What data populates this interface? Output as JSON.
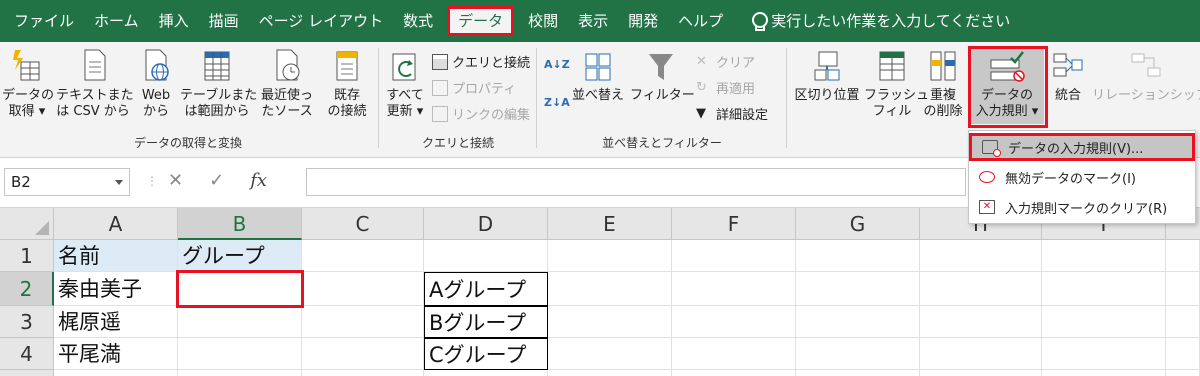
{
  "tabs": [
    "ファイル",
    "ホーム",
    "挿入",
    "描画",
    "ページ レイアウト",
    "数式",
    "データ",
    "校閲",
    "表示",
    "開発",
    "ヘルプ"
  ],
  "tell_me": "実行したい作業を入力してください",
  "ribbon": {
    "get_data": [
      "データの",
      "取得 ▾"
    ],
    "from_text": [
      "テキストまた",
      "は CSV から"
    ],
    "from_web": [
      "Web",
      "から"
    ],
    "from_table": [
      "テーブルまた",
      "は範囲から"
    ],
    "recent": [
      "最近使っ",
      "たソース"
    ],
    "existing": [
      "既存",
      "の接続"
    ],
    "refresh_all": [
      "すべて",
      "更新 ▾"
    ],
    "queries": "クエリと接続",
    "properties": "プロパティ",
    "edit_links": "リンクの編集",
    "sort": "並べ替え",
    "filter": "フィルター",
    "clear": "クリア",
    "reapply": "再適用",
    "advanced": "詳細設定",
    "text_to_columns": "区切り位置",
    "flash_fill": [
      "フラッシュ",
      "フィル"
    ],
    "remove_dup": [
      "重複",
      "の削除"
    ],
    "data_validation": [
      "データの",
      "入力規則 ▾"
    ],
    "consolidate": "統合",
    "relationships": "リレーションシップ",
    "group_get": "データの取得と変換",
    "group_queries": "クエリと接続",
    "group_sort": "並べ替えとフィルター"
  },
  "formula_bar": {
    "name_box": "B2",
    "fx": "fx",
    "cancel": "✕",
    "enter": "✓"
  },
  "columns": [
    "A",
    "B",
    "C",
    "D",
    "E",
    "F",
    "G",
    "H",
    "I"
  ],
  "rows": [
    "1",
    "2",
    "3",
    "4"
  ],
  "cells": {
    "A1": "名前",
    "B1": "グループ",
    "A2": "秦由美子",
    "A3": "梶原遥",
    "A4": "平尾満",
    "D2": "Aグループ",
    "D3": "Bグループ",
    "D4": "Cグループ"
  },
  "menu": {
    "items": [
      "データの入力規則(V)...",
      "無効データのマーク(I)",
      "入力規則マークのクリア(R)"
    ]
  },
  "colors": {
    "excel_green": "#217346",
    "highlight_red": "#e81123",
    "header_fill": "#ddebf7"
  }
}
